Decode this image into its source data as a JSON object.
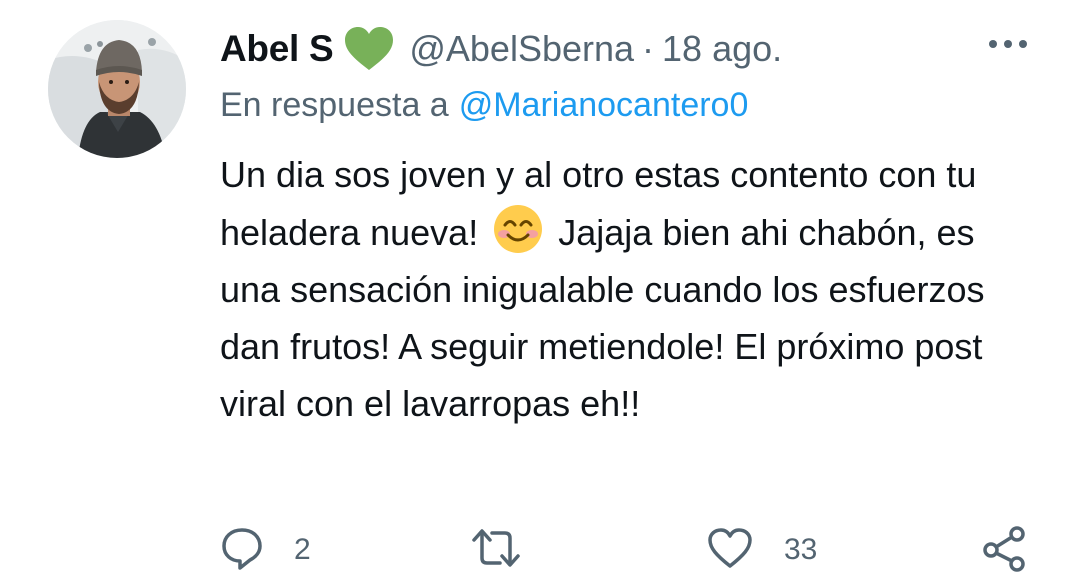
{
  "author": {
    "display_name": "Abel S",
    "handle": "@AbelSberna",
    "separator": "·",
    "date": "18 ago.",
    "badge": "green-heart-icon"
  },
  "reply": {
    "prefix": "En respuesta a",
    "mention": "@Marianocantero0"
  },
  "body": {
    "text_before_emoji": "Un dia sos joven y al otro estas contento con tu heladera nueva!",
    "emoji": "smiling-face-with-smiling-eyes",
    "text_after_emoji": "Jajaja bien ahi chabón, es una sensación inigualable cuando los esfuerzos dan frutos! A seguir metiendole! El próximo post viral con el lavarropas eh!!"
  },
  "actions": {
    "reply_count": "2",
    "retweet_count": "",
    "like_count": "33"
  },
  "colors": {
    "text": "#0f1419",
    "secondary": "#536471",
    "link": "#1d9bf0",
    "heart_badge": "#78b159"
  }
}
